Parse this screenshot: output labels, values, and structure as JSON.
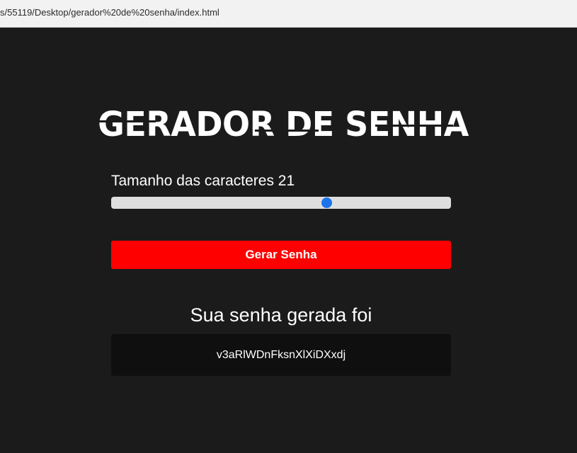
{
  "browser": {
    "url": "s/55119/Desktop/gerador%20de%20senha/index.html"
  },
  "page": {
    "title": "GERADOR DE SENHA",
    "size_label": "Tamanho das caracteres 21",
    "slider": {
      "value": 21,
      "fill_fraction": 0.635
    },
    "generate_button": "Gerar Senha",
    "result_heading": "Sua senha gerada foi",
    "password": "v3aRlWDnFksnXlXiDXxdj"
  },
  "colors": {
    "background": "#1b1b1b",
    "button": "#ff0000",
    "slider_thumb": "#1a73e8",
    "slider_track": "#dedede",
    "password_box": "#0f0f0f"
  }
}
